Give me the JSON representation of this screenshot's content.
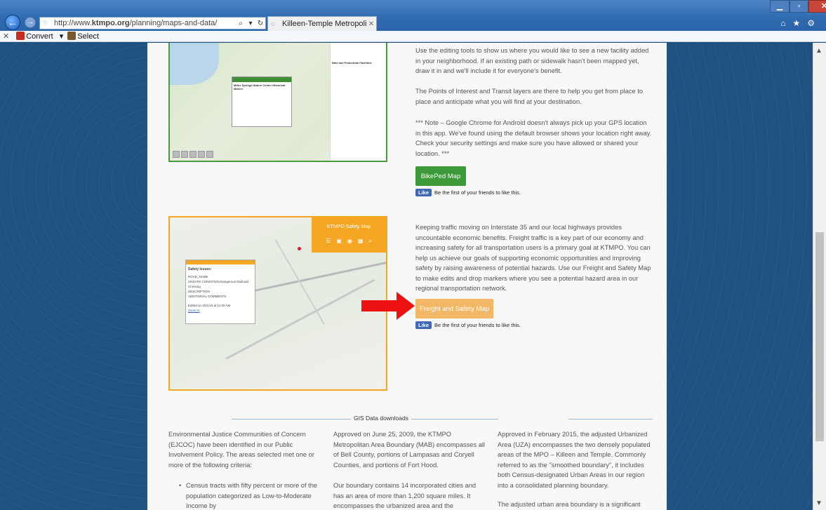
{
  "browser": {
    "url_prefix": "http://www.",
    "url_domain": "ktmpo.org",
    "url_path": "/planning/maps-and-data/",
    "tab_title": "Killeen-Temple Metropolita...",
    "command_bar": {
      "convert_label": "Convert",
      "select_label": "Select"
    }
  },
  "bikeped": {
    "paragraph1": "Use the editing tools to show us where you would like to see a new facility added in your neighborhood. If an existing path or sidewalk hasn't been mapped yet, draw it in and we'll include it for everyone's benefit.",
    "paragraph2": "The Points of Interest and Transit layers are there to help you get from place to place and anticipate what you will find at your destination.",
    "paragraph3": "*** Note – Google Chrome for Android doesn't always pick up your GPS location in this app. We've found using the default browser shows your location right away. Check your security settings and make sure you have allowed or shared your location. ***",
    "button_label": "BikePed Map",
    "like_label": "Like",
    "like_text": "Be the first of your friends to like this.",
    "map": {
      "popup_title": "Miller Springs Nature Center Historical Marker",
      "legend_title": "Bike and Pedestrian Facilities"
    }
  },
  "safety": {
    "paragraph": "Keeping traffic moving on Interstate 35 and our local highways provides uncountable economic benefits. Freight traffic is a key part of our economy and increasing safety for all transportation users is a primary goal at KTMPO. You can help us achieve our goals of supporting economic opportunities and improving safety by raising awareness of potential hazards. Use our Freight and Safety Map to make edits and drop markers where you see a potential hazard area in our regional transportation network.",
    "button_label": "Freight and Safety Map",
    "like_label": "Like",
    "like_text": "Be the first of your friends to like this.",
    "map": {
      "header_title": "KTMPO Safety Map",
      "popup_title": "Safety Issues:",
      "popup_lines": [
        "ROAD_NAME",
        "UNSAFE CONDITION    Dangerous Railroad Crossing",
        "DESCRIPTION",
        "ADDITIONAL COMMENTS",
        "Edited on 4/21/16 at 11:00 AM",
        "Zoom to"
      ]
    }
  },
  "gis": {
    "section_title": "GIS Data downloads",
    "col1_paragraph": "Environmental Justice Communities of Concern (EJCOC) have been identified in our Public Involvement Policy. The areas selected met one or more of the following criteria:",
    "col1_bullet": "Census tracts with fifty percent or more of the population categorized as Low-to-Moderate Income by",
    "col2_paragraph1": "Approved on June 25, 2009, the KTMPO Metropolitan Area Boundary (MAB) encompasses all of Bell County, portions of Lampasas and Coryell Counties, and portions of Fort Hood.",
    "col2_paragraph2": "Our boundary contains 14 incorporated cities and has an area of more than 1,200 square miles. It encompasses the urbanized area and the",
    "col3_paragraph1": "Approved in February 2015, the adjusted Urbanized Area (UZA) encompasses the two densely populated areas of the MPO – Killeen and Temple. Commonly referred to as the \"smoothed boundary\", it includes both Census-designated Urban Areas in our region into a consolidated planning boundary.",
    "col3_paragraph2": "The adjusted urban area boundary is a significant"
  },
  "colors": {
    "green_button": "#3d9a38",
    "orange_button": "#f2b868",
    "arrow": "#ee1111",
    "page_background": "#1f527f"
  }
}
